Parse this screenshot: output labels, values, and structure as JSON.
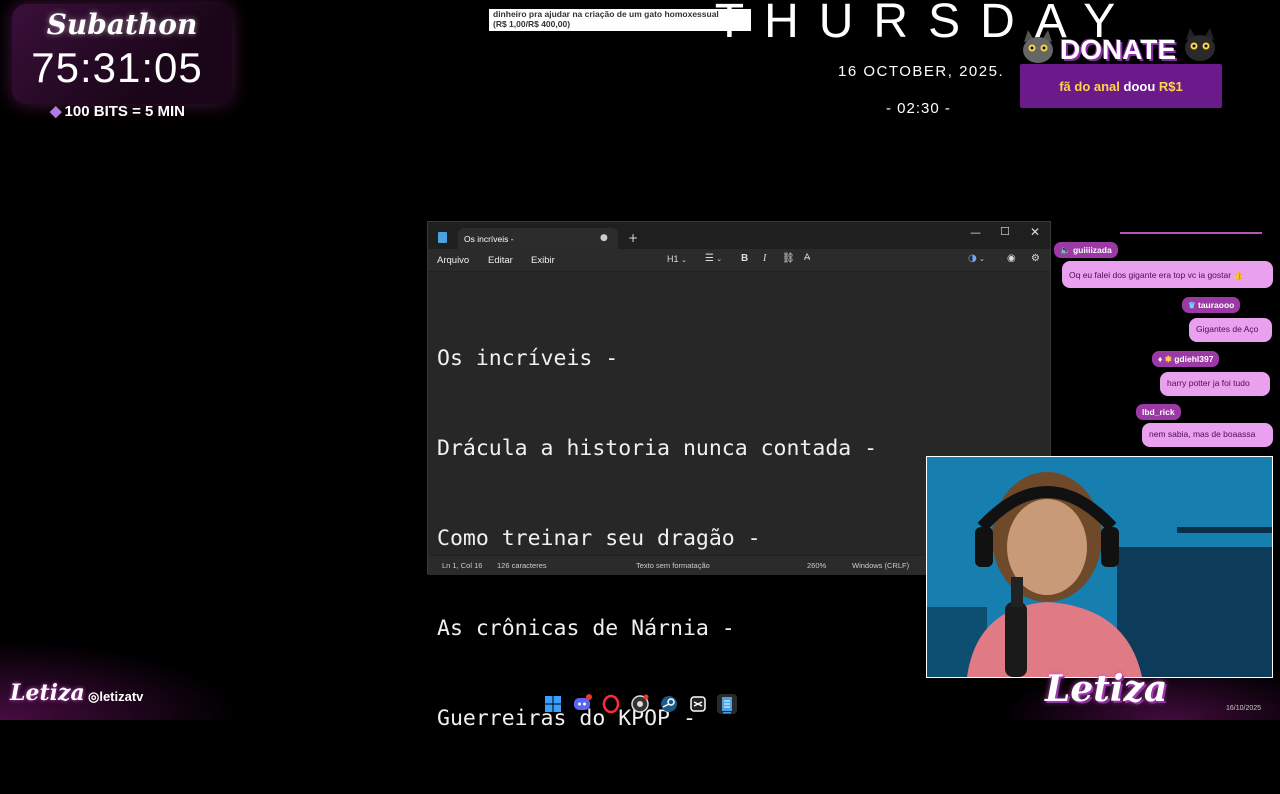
{
  "overlay": {
    "subathon_title": "Subathon",
    "subathon_timer": "75:31:05",
    "bits_rate": "100 BITS = 5 MIN",
    "donation_notice_line1": "dinheiro pra ajudar na criação de um gato homoxessual",
    "donation_notice_line2": "(R$ 1,00/R$ 400,00)",
    "day_name": "THURSDAY",
    "date_text": "16  OCTOBER, 2025.",
    "time_text": "- 02:30 -",
    "donate_title": "DONATE",
    "donate_user": "fã do anal",
    "donate_verb": " doou ",
    "donate_amount": "R$1",
    "brand_left": "Letiza",
    "instagram_handle": "letizatv",
    "brand_right": "Letiza",
    "corner_date": "16/10/2025"
  },
  "notepad": {
    "tab_title": "Os incríveis -",
    "menu": [
      "Arquivo",
      "Editar",
      "Exibir"
    ],
    "heading_control": "H1",
    "content_lines": [
      "Os incríveis -",
      "Drácula a historia nunca contada -",
      "Como treinar seu dragão -",
      "As crônicas de Nárnia -",
      "Guerreiras do KPOP -"
    ],
    "status": {
      "position": "Ln 1, Col 16",
      "characters": "126 caracteres",
      "format": "Texto sem formatação",
      "zoom": "260%",
      "line_endings": "Windows (CRLF)"
    }
  },
  "chat": [
    {
      "user": "guiiiizada",
      "message": "Oq eu falei dos gigante era top vc ia gostar 👍"
    },
    {
      "user": "tauraooo",
      "message": "Gigantes de Aço"
    },
    {
      "user": "gdiehl397",
      "message": "harry potter ja foi tudo"
    },
    {
      "user": "lbd_rick",
      "message": "nem sabia, mas de boaassa"
    }
  ],
  "colors": {
    "accent_purple": "#9c3aa5",
    "chat_bubble": "#e9a0ee",
    "donate_bg": "#6a1a8a",
    "notepad_bg": "#272727",
    "highlight_yellow": "#ffd54a"
  },
  "taskbar_icons": [
    "windows-icon",
    "discord-icon",
    "opera-gx-icon",
    "obs-icon",
    "steam-icon",
    "capcut-icon",
    "notepad-icon"
  ]
}
